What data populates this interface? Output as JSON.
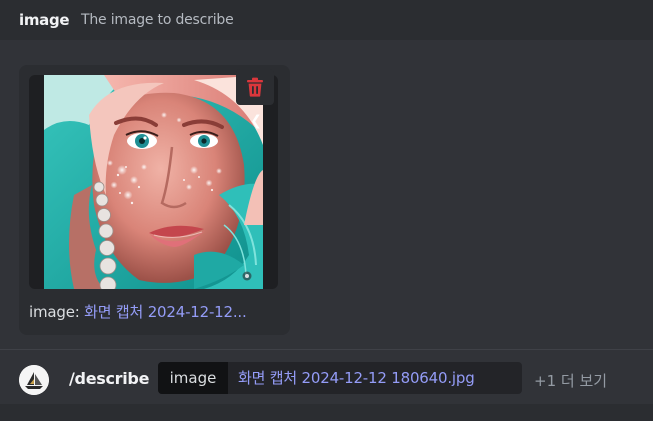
{
  "option": {
    "name": "image",
    "description": "The image to describe"
  },
  "attachment": {
    "caption_prefix": "image: ",
    "caption_value": "화면 캡처 2024-12-12...",
    "delete_icon": "trash-icon"
  },
  "command": {
    "name": "/describe",
    "param_label": "image",
    "param_value": "화면 캡처 2024-12-12 180640.jpg",
    "more_label": "+1 더 보기"
  },
  "colors": {
    "accent": "#949cf7",
    "danger": "#da373c",
    "background": "#313338",
    "header": "#2b2d31"
  }
}
